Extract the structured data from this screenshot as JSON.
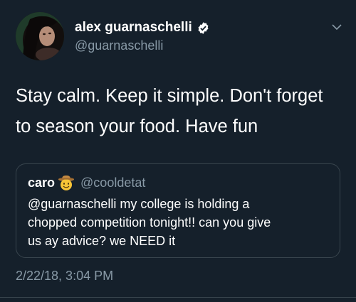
{
  "tweet": {
    "display_name": "alex guarnaschelli",
    "handle": "@guarnaschelli",
    "verified_icon": "verified-badge-icon",
    "text": "Stay calm.  Keep it simple.  Don't forget\nto season your food.  Have fun",
    "timestamp": "2/22/18, 3:04 PM"
  },
  "quoted_tweet": {
    "display_name": "caro",
    "emoji_icon": "cowboy-emoji-icon",
    "handle": "@cooldetat",
    "text": "@guarnaschelli my college is holding a\nchopped competition tonight!! can you give\nus ay advice? we NEED it"
  },
  "colors": {
    "background": "#15202b",
    "secondary_text": "#8899a6",
    "border": "#38444d",
    "verified_badge": "#ffffff"
  }
}
